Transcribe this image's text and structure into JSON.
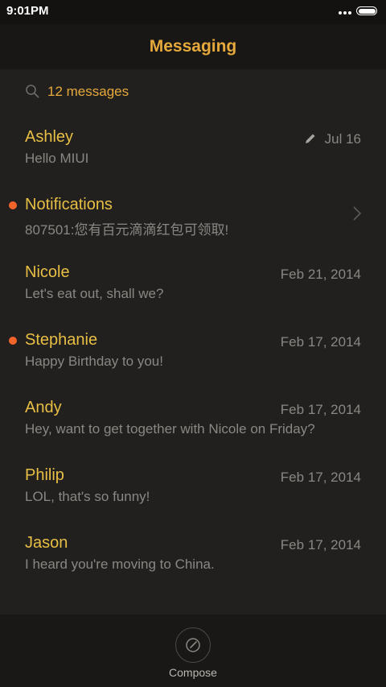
{
  "status_bar": {
    "time": "9:01PM",
    "battery_level": 1.0
  },
  "header": {
    "title": "Messaging"
  },
  "search": {
    "count_label": "12 messages",
    "icon": "search-icon"
  },
  "messages": [
    {
      "name": "Ashley",
      "preview": "Hello MIUI",
      "date": "Jul 16",
      "unread": false,
      "draft": true,
      "chevron": false
    },
    {
      "name": "Notifications",
      "preview": "807501:您有百元滴滴红包可领取!",
      "date": "",
      "unread": true,
      "draft": false,
      "chevron": true
    },
    {
      "name": "Nicole",
      "preview": "Let's eat out, shall we?",
      "date": "Feb 21, 2014",
      "unread": false,
      "draft": false,
      "chevron": false
    },
    {
      "name": "Stephanie",
      "preview": "Happy Birthday to you!",
      "date": "Feb 17, 2014",
      "unread": true,
      "draft": false,
      "chevron": false
    },
    {
      "name": "Andy",
      "preview": "Hey, want to get together with Nicole on Friday?",
      "date": "Feb 17, 2014",
      "unread": false,
      "draft": false,
      "chevron": false
    },
    {
      "name": "Philip",
      "preview": "LOL, that's so funny!",
      "date": "Feb 17, 2014",
      "unread": false,
      "draft": false,
      "chevron": false
    },
    {
      "name": "Jason",
      "preview": "I heard you're moving to China.",
      "date": "Feb 17, 2014",
      "unread": false,
      "draft": false,
      "chevron": false
    }
  ],
  "bottom_bar": {
    "compose_label": "Compose",
    "compose_icon": "compose-icon"
  },
  "colors": {
    "accent": "#e6a93b",
    "contact_name": "#e8bf45",
    "unread_dot": "#f2642a",
    "secondary_text": "#8a8783",
    "background": "#22201e"
  }
}
